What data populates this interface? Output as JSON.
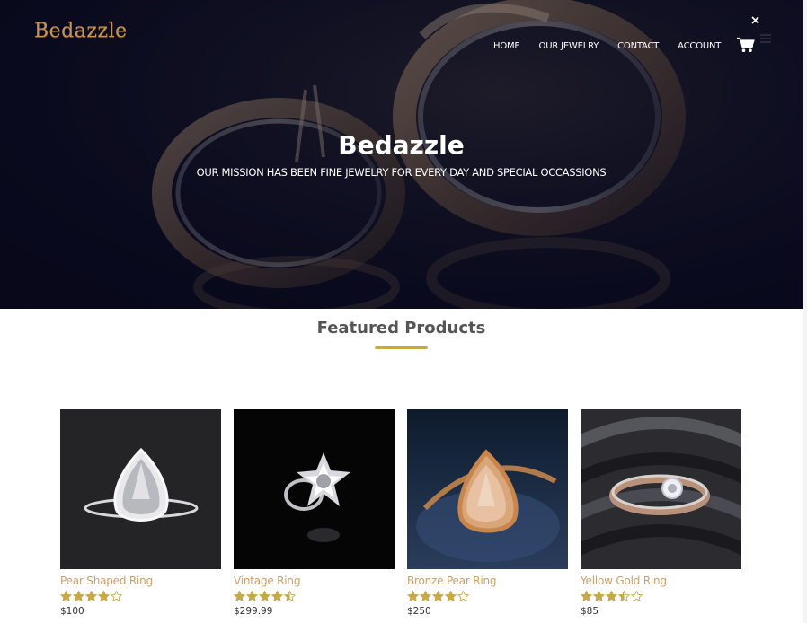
{
  "brand": {
    "logo_text": "Bedazzle",
    "logo_color": "#c7925a"
  },
  "nav": {
    "items": [
      {
        "label": "HOME"
      },
      {
        "label": "OUR JEWELRY"
      },
      {
        "label": "CONTACT"
      },
      {
        "label": "ACCOUNT"
      }
    ],
    "cart_icon": "shopping-cart-icon",
    "close_icon": "close-icon",
    "menu_icon": "hamburger-menu-icon"
  },
  "hero": {
    "title": "Bedazzle",
    "subtitle": "OUR MISSION HAS BEEN FINE JEWELRY FOR EVERY DAY AND SPECIAL OCCASSIONS",
    "background_color": "#0a0b1e"
  },
  "featured": {
    "title": "Featured Products",
    "accent_color": "#c9a84c",
    "products": [
      {
        "name": "Pear Shaped Ring",
        "rating": 4.0,
        "price": "$100"
      },
      {
        "name": "Vintage Ring",
        "rating": 4.5,
        "price": "$299.99"
      },
      {
        "name": "Bronze Pear Ring",
        "rating": 4.0,
        "price": "$250"
      },
      {
        "name": "Yellow Gold Ring",
        "rating": 3.5,
        "price": "$85"
      }
    ]
  },
  "colors": {
    "product_name": "#c9a06b",
    "star": "#c9a84c",
    "price": "#333333"
  }
}
